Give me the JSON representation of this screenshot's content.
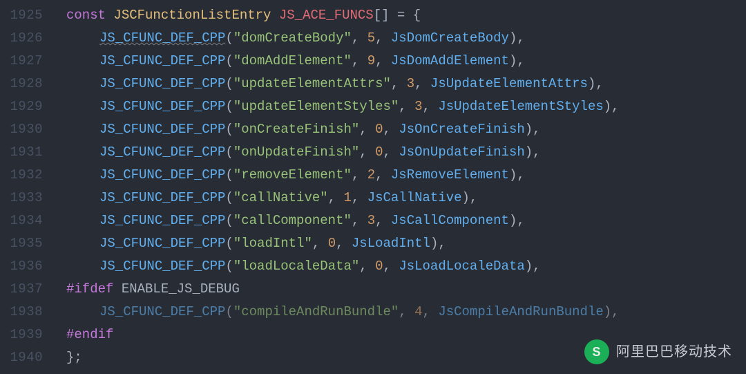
{
  "startLine": 1925,
  "decl": {
    "const": "const",
    "type": "JSCFunctionListEntry",
    "name": "JS_ACE_FUNCS",
    "brackets": "[]",
    "eq": "=",
    "open": "{"
  },
  "macro": "JS_CFUNC_DEF_CPP",
  "entries": [
    {
      "s": "\"domCreateBody\"",
      "n": "5",
      "fn": "JsDomCreateBody",
      "dim": false,
      "wavy": true
    },
    {
      "s": "\"domAddElement\"",
      "n": "9",
      "fn": "JsDomAddElement",
      "dim": false,
      "wavy": false
    },
    {
      "s": "\"updateElementAttrs\"",
      "n": "3",
      "fn": "JsUpdateElementAttrs",
      "dim": false,
      "wavy": false
    },
    {
      "s": "\"updateElementStyles\"",
      "n": "3",
      "fn": "JsUpdateElementStyles",
      "dim": false,
      "wavy": false
    },
    {
      "s": "\"onCreateFinish\"",
      "n": "0",
      "fn": "JsOnCreateFinish",
      "dim": false,
      "wavy": false
    },
    {
      "s": "\"onUpdateFinish\"",
      "n": "0",
      "fn": "JsOnUpdateFinish",
      "dim": false,
      "wavy": false
    },
    {
      "s": "\"removeElement\"",
      "n": "2",
      "fn": "JsRemoveElement",
      "dim": false,
      "wavy": false
    },
    {
      "s": "\"callNative\"",
      "n": "1",
      "fn": "JsCallNative",
      "dim": false,
      "wavy": false
    },
    {
      "s": "\"callComponent\"",
      "n": "3",
      "fn": "JsCallComponent",
      "dim": false,
      "wavy": false
    },
    {
      "s": "\"loadIntl\"",
      "n": "0",
      "fn": "JsLoadIntl",
      "dim": false,
      "wavy": false
    },
    {
      "s": "\"loadLocaleData\"",
      "n": "0",
      "fn": "JsLoadLocaleData",
      "dim": false,
      "wavy": false
    }
  ],
  "ifdef": {
    "kw": "#ifdef",
    "sym": "ENABLE_JS_DEBUG"
  },
  "ifdefEntry": {
    "s": "\"compileAndRunBundle\"",
    "n": "4",
    "fn": "JsCompileAndRunBundle"
  },
  "endif": "#endif",
  "close": "};",
  "watermark": {
    "logo": "S",
    "text": "阿里巴巴移动技术"
  }
}
